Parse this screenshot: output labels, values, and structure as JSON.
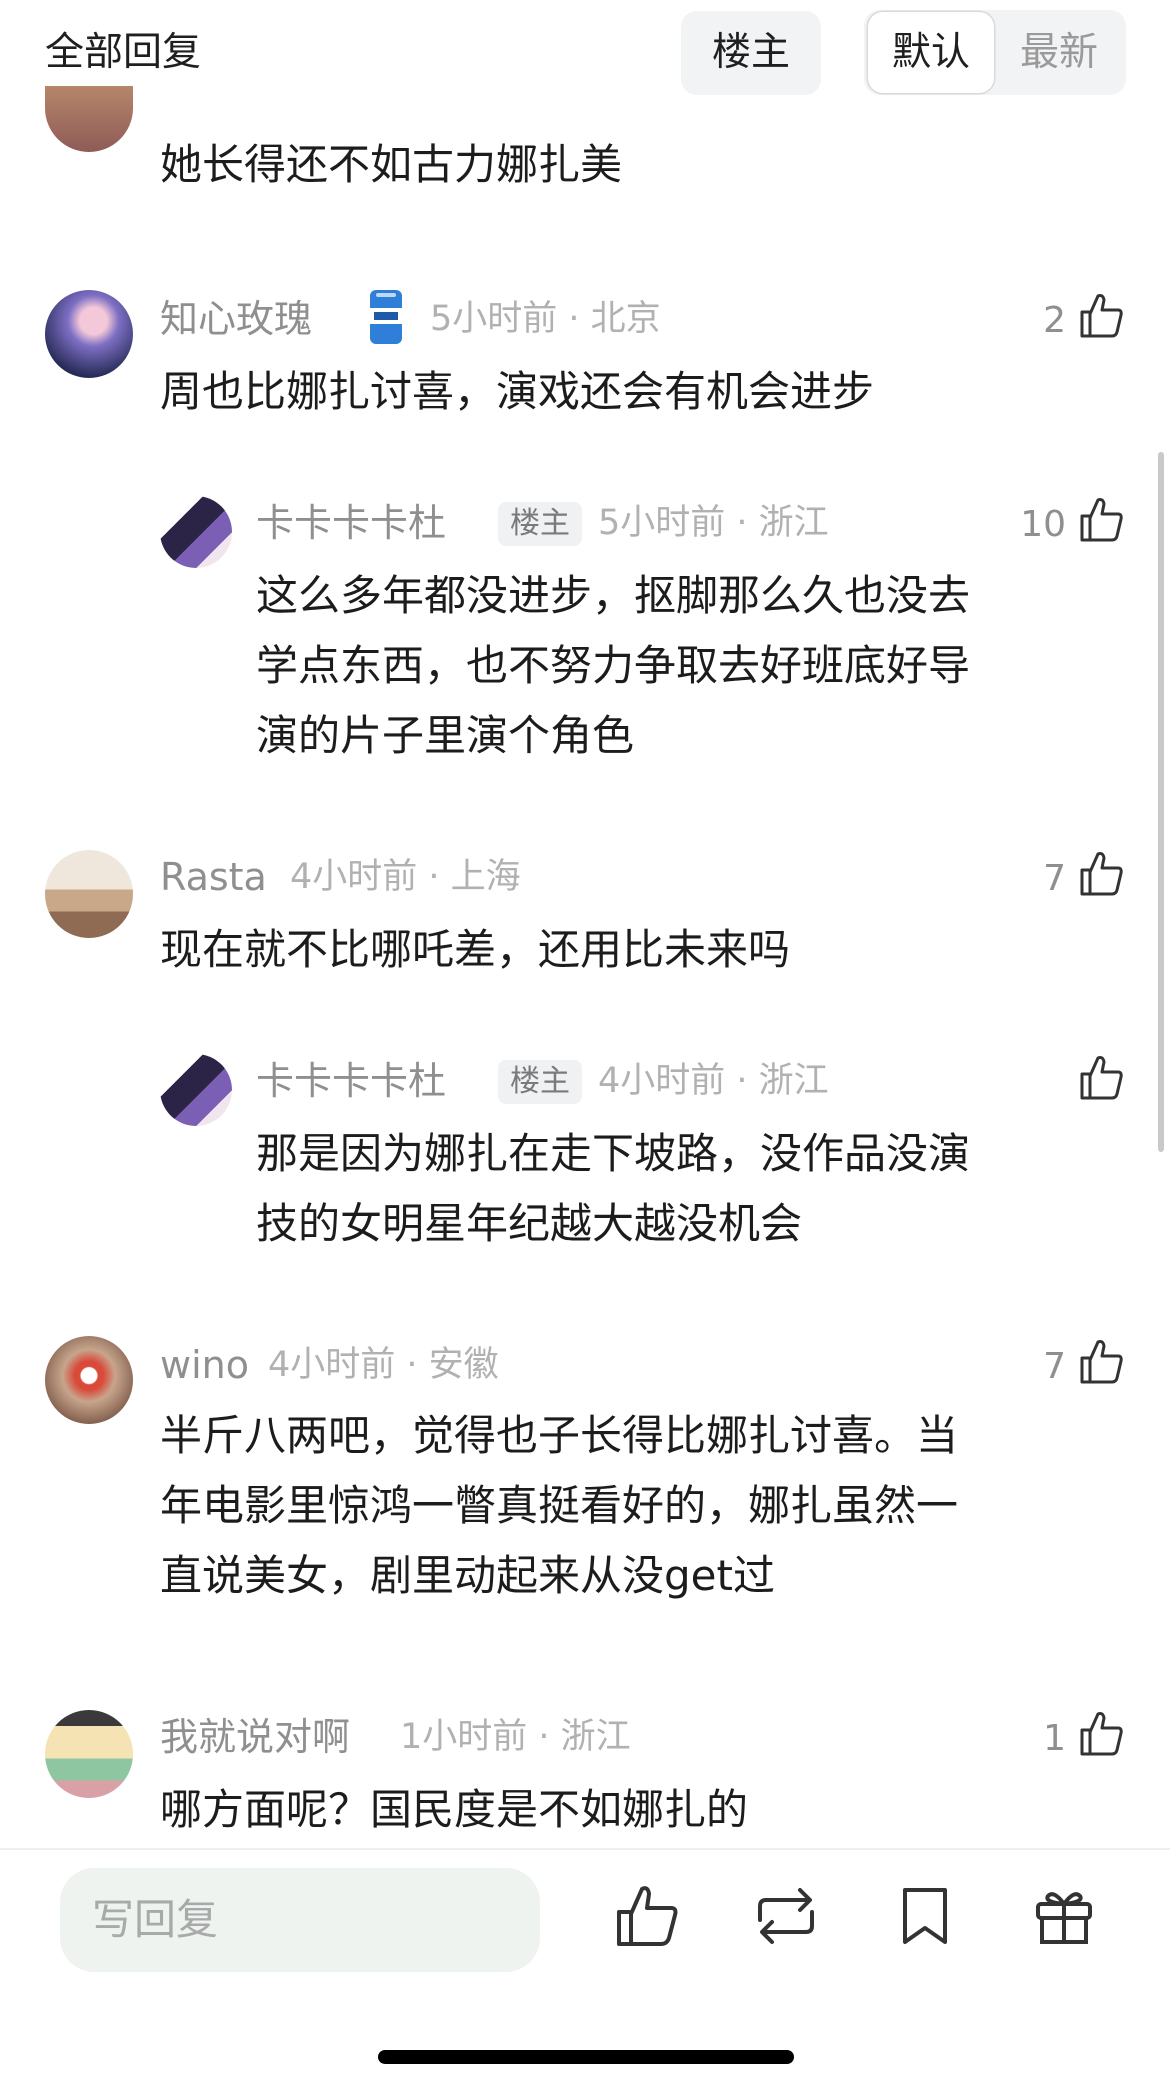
{
  "header": {
    "title": "全部回复",
    "op_filter": "楼主",
    "sort_default": "默认",
    "sort_latest": "最新"
  },
  "badge_icon": "beer-can-icon",
  "comments": [
    {
      "body": "她长得还不如古力娜扎美"
    },
    {
      "name": "知心玫瑰",
      "meta": "5小时前 · 北京",
      "likes": "2",
      "body": "周也比娜扎讨喜，演戏还会有机会进步"
    },
    {
      "name": "卡卡卡卡杜",
      "op_badge": "楼主",
      "meta": "5小时前 · 浙江",
      "likes": "10",
      "body_lines": [
        "这么多年都没进步，抠脚那么久也没去",
        "学点东西，也不努力争取去好班底好导",
        "演的片子里演个角色"
      ]
    },
    {
      "name": "Rasta",
      "meta": "4小时前 · 上海",
      "likes": "7",
      "body": "现在就不比哪吒差，还用比未来吗"
    },
    {
      "name": "卡卡卡卡杜",
      "op_badge": "楼主",
      "meta": "4小时前 · 浙江",
      "body_lines": [
        "那是因为娜扎在走下坡路，没作品没演",
        "技的女明星年纪越大越没机会"
      ]
    },
    {
      "name": "wino",
      "meta": "4小时前 · 安徽",
      "likes": "7",
      "body_lines": [
        "半斤八两吧，觉得也子长得比娜扎讨喜。当",
        "年电影里惊鸿一瞥真挺看好的，娜扎虽然一",
        "直说美女，剧里动起来从没get过"
      ]
    },
    {
      "name": "我就说对啊",
      "meta": "1小时前 · 浙江",
      "likes": "1",
      "body": "哪方面呢？国民度是不如娜扎的"
    }
  ],
  "bottom_bar": {
    "reply_placeholder": "写回复",
    "icons": [
      "like-icon",
      "repost-icon",
      "bookmark-icon",
      "gift-icon"
    ]
  }
}
